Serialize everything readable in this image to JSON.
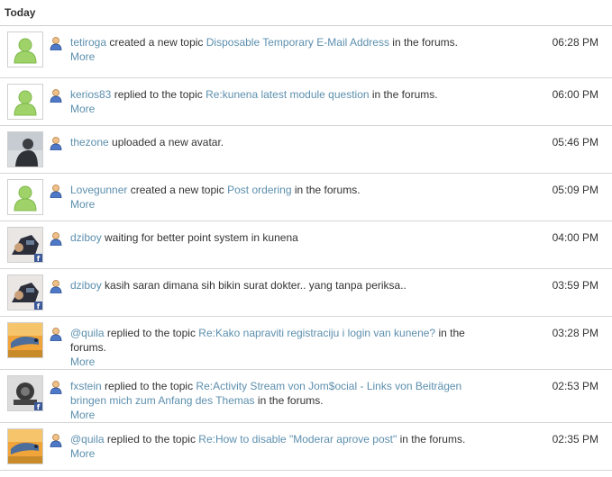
{
  "header": {
    "title": "Today"
  },
  "more_label": "More",
  "in_forums": " in the forums.",
  "rows": [
    {
      "avatar": "default-avatar",
      "user": "tetiroga",
      "action": " created a new topic ",
      "topic": "Disposable Temporary E-Mail Address",
      "suffix": " in the forums.",
      "time": "06:28 PM",
      "more": true
    },
    {
      "avatar": "default-avatar",
      "user": "kerios83",
      "action": " replied to the topic ",
      "topic": "Re:kunena latest module question",
      "suffix": " in the forums.",
      "time": "06:00 PM",
      "more": true
    },
    {
      "avatar": "photo-person",
      "user": "thezone",
      "action": " uploaded a new avatar.",
      "topic": "",
      "suffix": "",
      "time": "05:46 PM",
      "more": false
    },
    {
      "avatar": "default-avatar",
      "user": "Lovegunner",
      "action": " created a new topic ",
      "topic": "Post ordering",
      "suffix": " in the forums.",
      "time": "05:09 PM",
      "more": true
    },
    {
      "avatar": "photo-facebook",
      "user": "dziboy",
      "action": " waiting for better point system in kunena",
      "topic": "",
      "suffix": "",
      "time": "04:00 PM",
      "more": false
    },
    {
      "avatar": "photo-facebook",
      "user": "dziboy",
      "action": " kasih saran dimana sih bikin surat dokter.. yang tanpa periksa..",
      "topic": "",
      "suffix": "",
      "time": "03:59 PM",
      "more": false
    },
    {
      "avatar": "photo-lizard",
      "user": "@quila",
      "action": " replied to the topic ",
      "topic": "Re:Kako napraviti registraciju i login van kunene?",
      "suffix": " in the forums.",
      "time": "03:28 PM",
      "more": true
    },
    {
      "avatar": "photo-bike-facebook",
      "user": "fxstein",
      "action": " replied to the topic ",
      "topic": "Re:Activity Stream von Jom$ocial - Links von Beiträgen bringen mich zum Anfang des Themas",
      "suffix": " in the forums.",
      "time": "02:53 PM",
      "more": true
    },
    {
      "avatar": "photo-lizard",
      "user": "@quila",
      "action": " replied to the topic ",
      "topic": "Re:How to disable \"Moderar aprove post\"",
      "suffix": " in the forums.",
      "time": "02:35 PM",
      "more": true
    }
  ]
}
